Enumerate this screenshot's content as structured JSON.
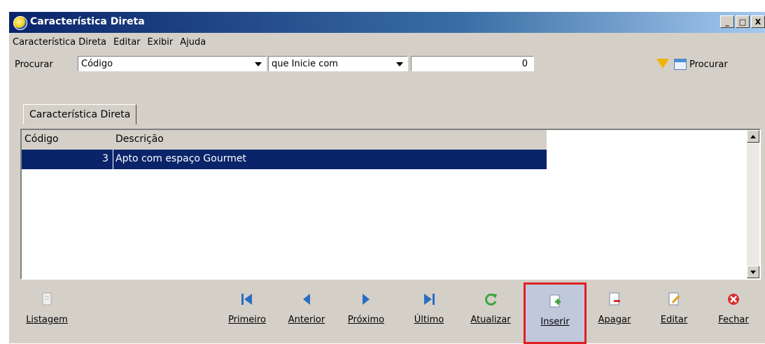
{
  "window": {
    "title": "Característica Direta",
    "controls": [
      "_",
      "□",
      "X"
    ]
  },
  "menu": [
    "Característica Direta",
    "Editar",
    "Exibir",
    "Ajuda"
  ],
  "search": {
    "label": "Procurar",
    "field": "Código",
    "condition": "que Inicie com",
    "value": "0",
    "button": "Procurar"
  },
  "tab": {
    "label": "Característica Direta"
  },
  "grid": {
    "columns": [
      "Código",
      "Descrição"
    ],
    "rows": [
      {
        "codigo": "3",
        "descricao": "Apto com espaço Gourmet"
      }
    ]
  },
  "toolbar": {
    "listagem": "Listagem",
    "primeiro": "Primeiro",
    "anterior": "Anterior",
    "proximo": "Próximo",
    "ultimo": "Último",
    "atualizar": "Atualizar",
    "inserir": "Inserir",
    "apagar": "Apagar",
    "editar": "Editar",
    "fechar": "Fechar"
  },
  "colors": {
    "title_bar": "#0a246a",
    "selection": "#0a246a",
    "highlight_border": "#e02020"
  }
}
